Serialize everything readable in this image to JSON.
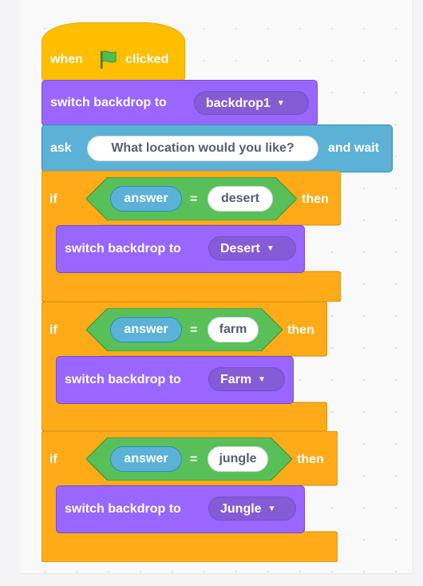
{
  "script": {
    "hat": {
      "when_label": "when",
      "flag_icon": "green-flag-icon",
      "clicked_label": "clicked"
    },
    "switch_backdrop_1": {
      "label": "switch backdrop to",
      "value": "backdrop1"
    },
    "ask": {
      "label": "ask",
      "question": "What location would you like?",
      "wait_label": "and wait"
    },
    "if_blocks": [
      {
        "if_label": "if",
        "then_label": "then",
        "operand_left": "answer",
        "operator": "=",
        "operand_right": "desert",
        "inner_label": "switch backdrop to",
        "inner_value": "Desert"
      },
      {
        "if_label": "if",
        "then_label": "then",
        "operand_left": "answer",
        "operator": "=",
        "operand_right": "farm",
        "inner_label": "switch backdrop to",
        "inner_value": "Farm"
      },
      {
        "if_label": "if",
        "then_label": "then",
        "operand_left": "answer",
        "operator": "=",
        "operand_right": "jungle",
        "inner_label": "switch backdrop to",
        "inner_value": "Jungle"
      }
    ],
    "dropdown_caret": "▼"
  },
  "colors": {
    "events": "#ffbf00",
    "looks": "#9966ff",
    "sensing": "#5cb1d6",
    "control": "#ffab19",
    "operators": "#59c059"
  }
}
